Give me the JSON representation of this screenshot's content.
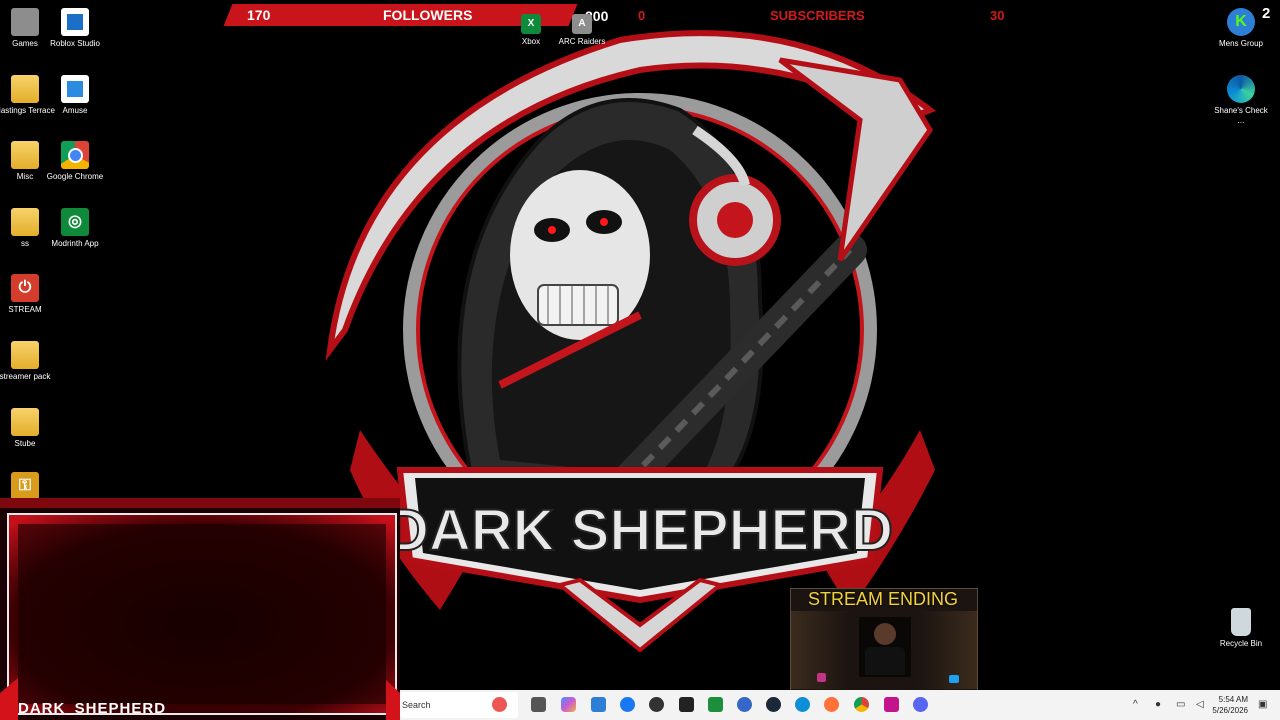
{
  "top_bar": {
    "followers_count": "170",
    "followers_label": "FOLLOWERS",
    "followers_goal": "200",
    "subscribers_count": "0",
    "subscribers_label": "SUBSCRIBERS",
    "subscribers_goal": "30"
  },
  "desktop_left": [
    {
      "label": "Games",
      "icon": "games-icon"
    },
    {
      "label": "Roblox Studio",
      "icon": "roblox-studio-icon"
    },
    {
      "label": "Hastings Terrace",
      "icon": "folder-icon"
    },
    {
      "label": "Amuse",
      "icon": "amuse-icon"
    },
    {
      "label": "Misc",
      "icon": "folder-icon"
    },
    {
      "label": "Google Chrome",
      "icon": "chrome-icon"
    },
    {
      "label": "ss",
      "icon": "folder-icon"
    },
    {
      "label": "Modrinth App",
      "icon": "modrinth-icon"
    },
    {
      "label": "STREAM",
      "icon": "power-icon"
    },
    {
      "label": "streamer pack",
      "icon": "folder-icon"
    },
    {
      "label": "Stube",
      "icon": "folder-icon"
    }
  ],
  "desktop_top": [
    {
      "label": "Xbox",
      "icon": "xbox-icon"
    },
    {
      "label": "ARC Raiders",
      "icon": "arc-raiders-icon"
    }
  ],
  "desktop_right": [
    {
      "label": "Mens Group",
      "icon": "kick-icon"
    },
    {
      "label": "Shane's Check ...",
      "icon": "edge-icon"
    },
    {
      "label": "Recycle Bin",
      "icon": "recycle-bin-icon"
    }
  ],
  "overlay_corner_number": "2",
  "wallpaper_title": "DARK SHEPHERD",
  "webcam_name": "DARK_SHEPHERD",
  "stream_ending_label": "STREAM ENDING",
  "taskbar": {
    "search_placeholder": "Search",
    "time": "5:54 AM",
    "date": "5/26/2026"
  },
  "colors": {
    "accent_red": "#c9141b",
    "stream_ending_yellow": "#f2d23b",
    "taskbar_bg": "#f3f3f3"
  }
}
